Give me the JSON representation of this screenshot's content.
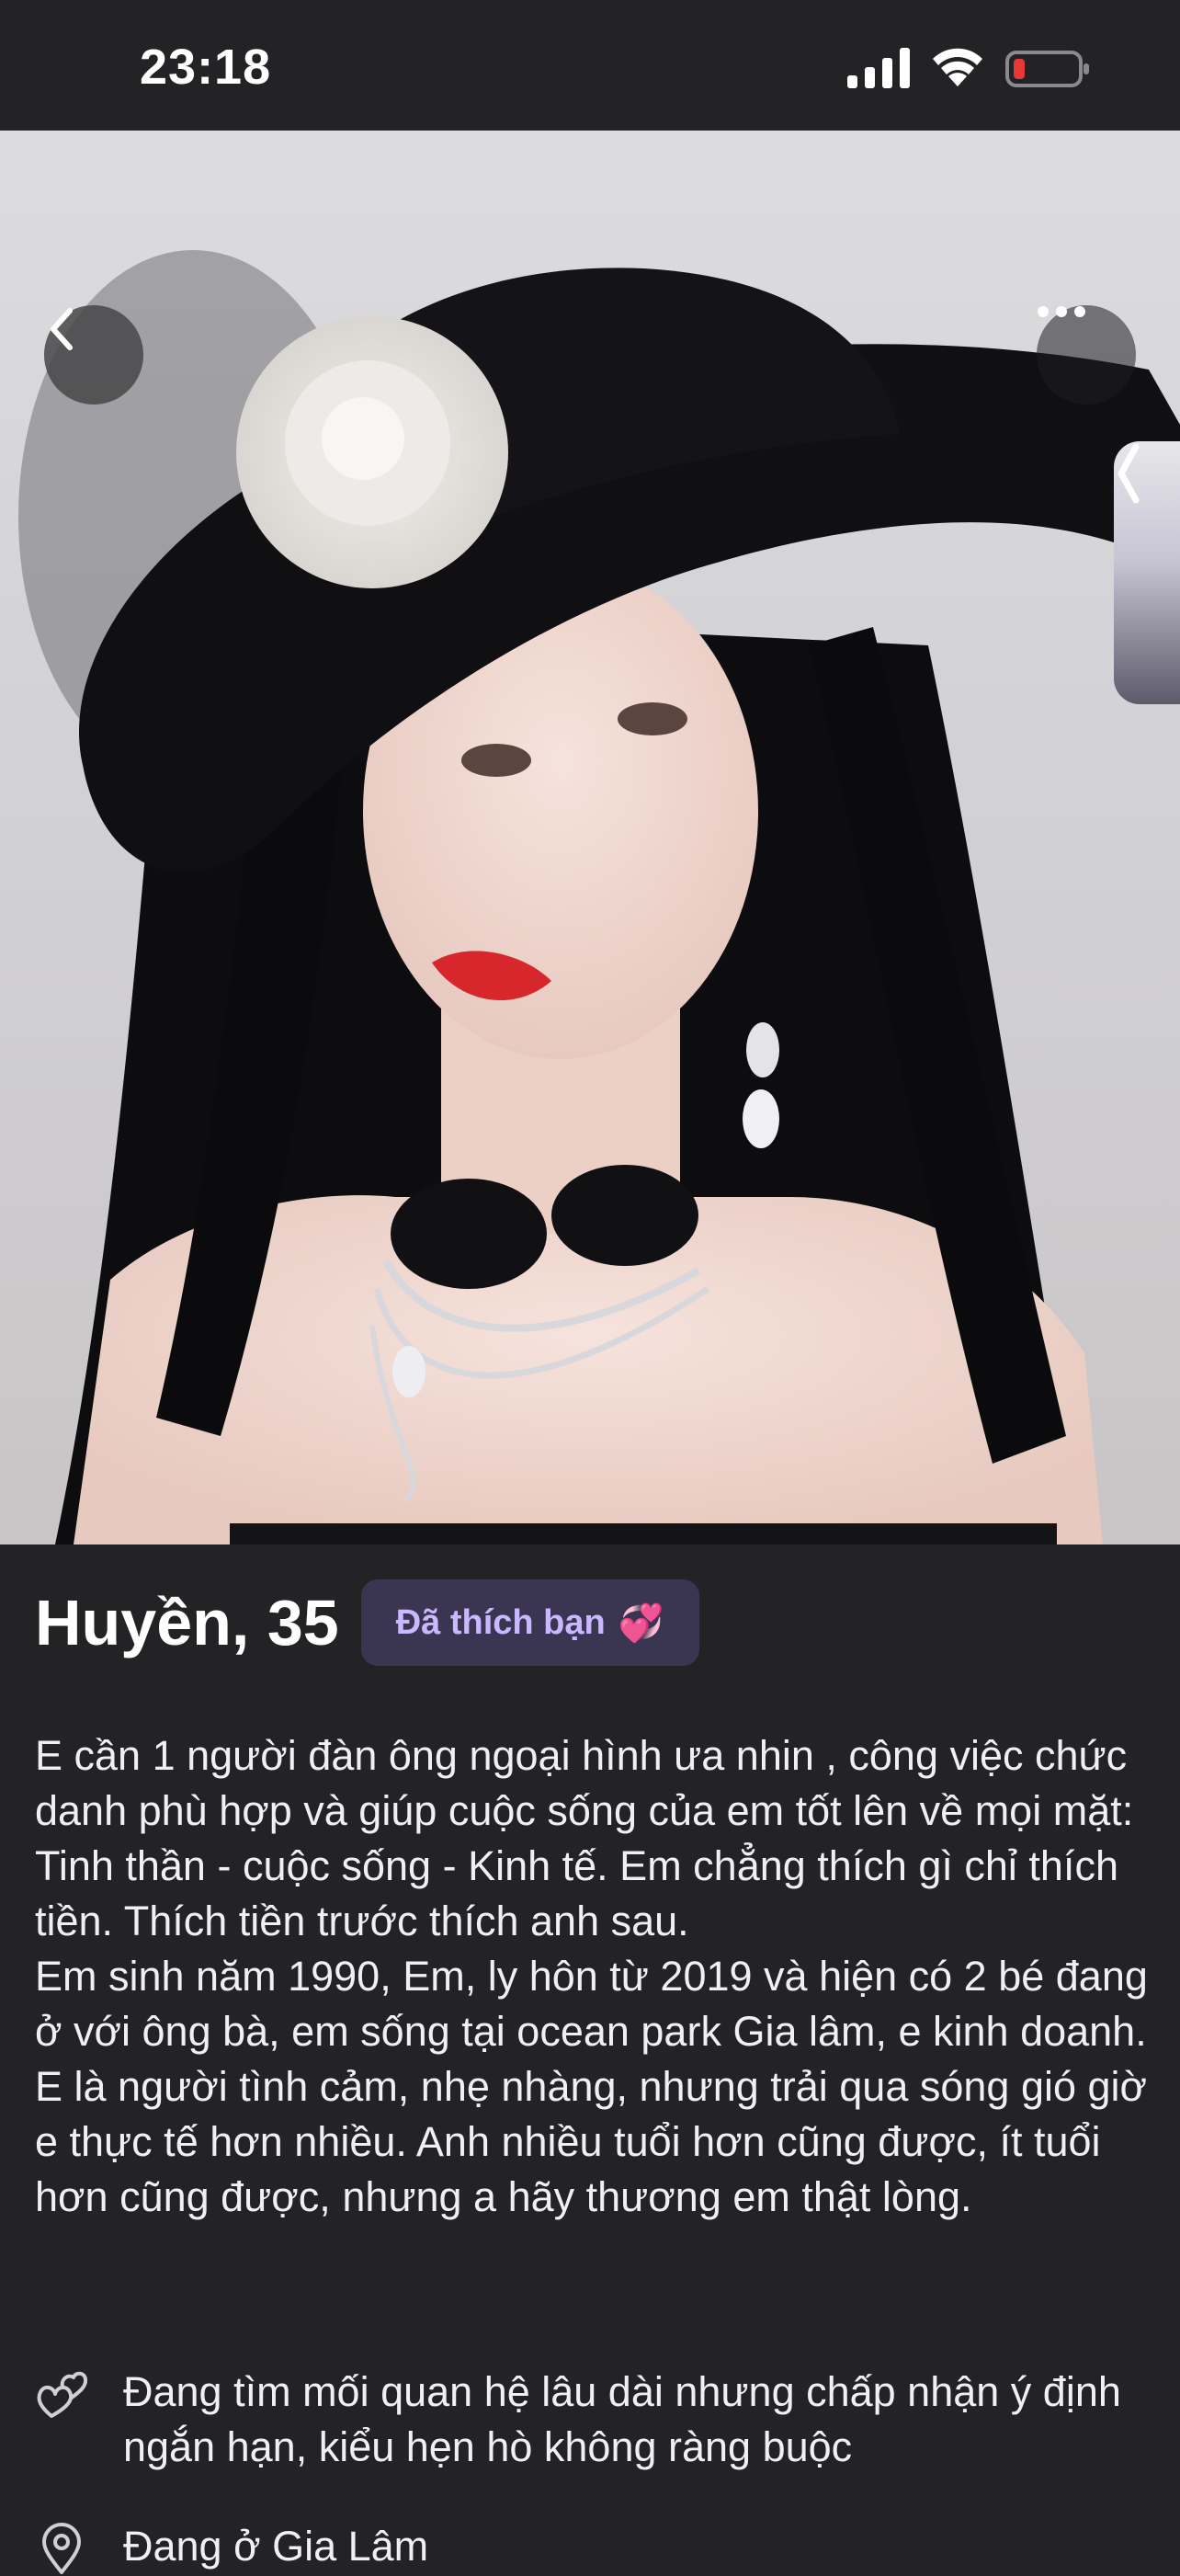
{
  "status_bar": {
    "time": "23:18",
    "icons": [
      "signal-icon",
      "wifi-icon",
      "battery-low-icon"
    ]
  },
  "photo": {
    "back_icon": "chevron-left-icon",
    "more_icon": "ellipsis-icon",
    "side_handle_icon": "chevron-left-icon"
  },
  "profile": {
    "name_age": "Huyền, 35",
    "liked_badge": "Đã thích bạn",
    "liked_emoji": "💞",
    "bio": "E cần 1 người đàn ông ngoại hình ưa nhin , công việc chức danh phù hợp và giúp cuộc sống của em tốt lên về mọi mặt: Tinh thần - cuộc sống - Kinh tế. Em chẳng thích gì chỉ thích tiền. Thích tiền trước thích anh sau.\nEm sinh năm 1990, Em, ly hôn từ 2019 và hiện có 2 bé đang ở với ông bà, em sống tại ocean park Gia lâm, e kinh doanh. E là người tình cảm, nhẹ nhàng, nhưng trải qua sóng gió giờ e thực tế hơn nhiều. Anh nhiều tuổi hơn cũng được, ít tuổi hơn cũng được, nhưng a hãy thương em thật lòng.",
    "looking_for": "Đang tìm mối quan hệ lâu dài nhưng chấp nhận ý định ngắn hạn, kiểu hẹn hò không ràng buộc",
    "location": "Đang ở Gia Lâm"
  },
  "colors": {
    "background": "#232326",
    "badge_bg": "#3a3551",
    "badge_text": "#c9b8ff",
    "battery_low": "#e53935"
  }
}
